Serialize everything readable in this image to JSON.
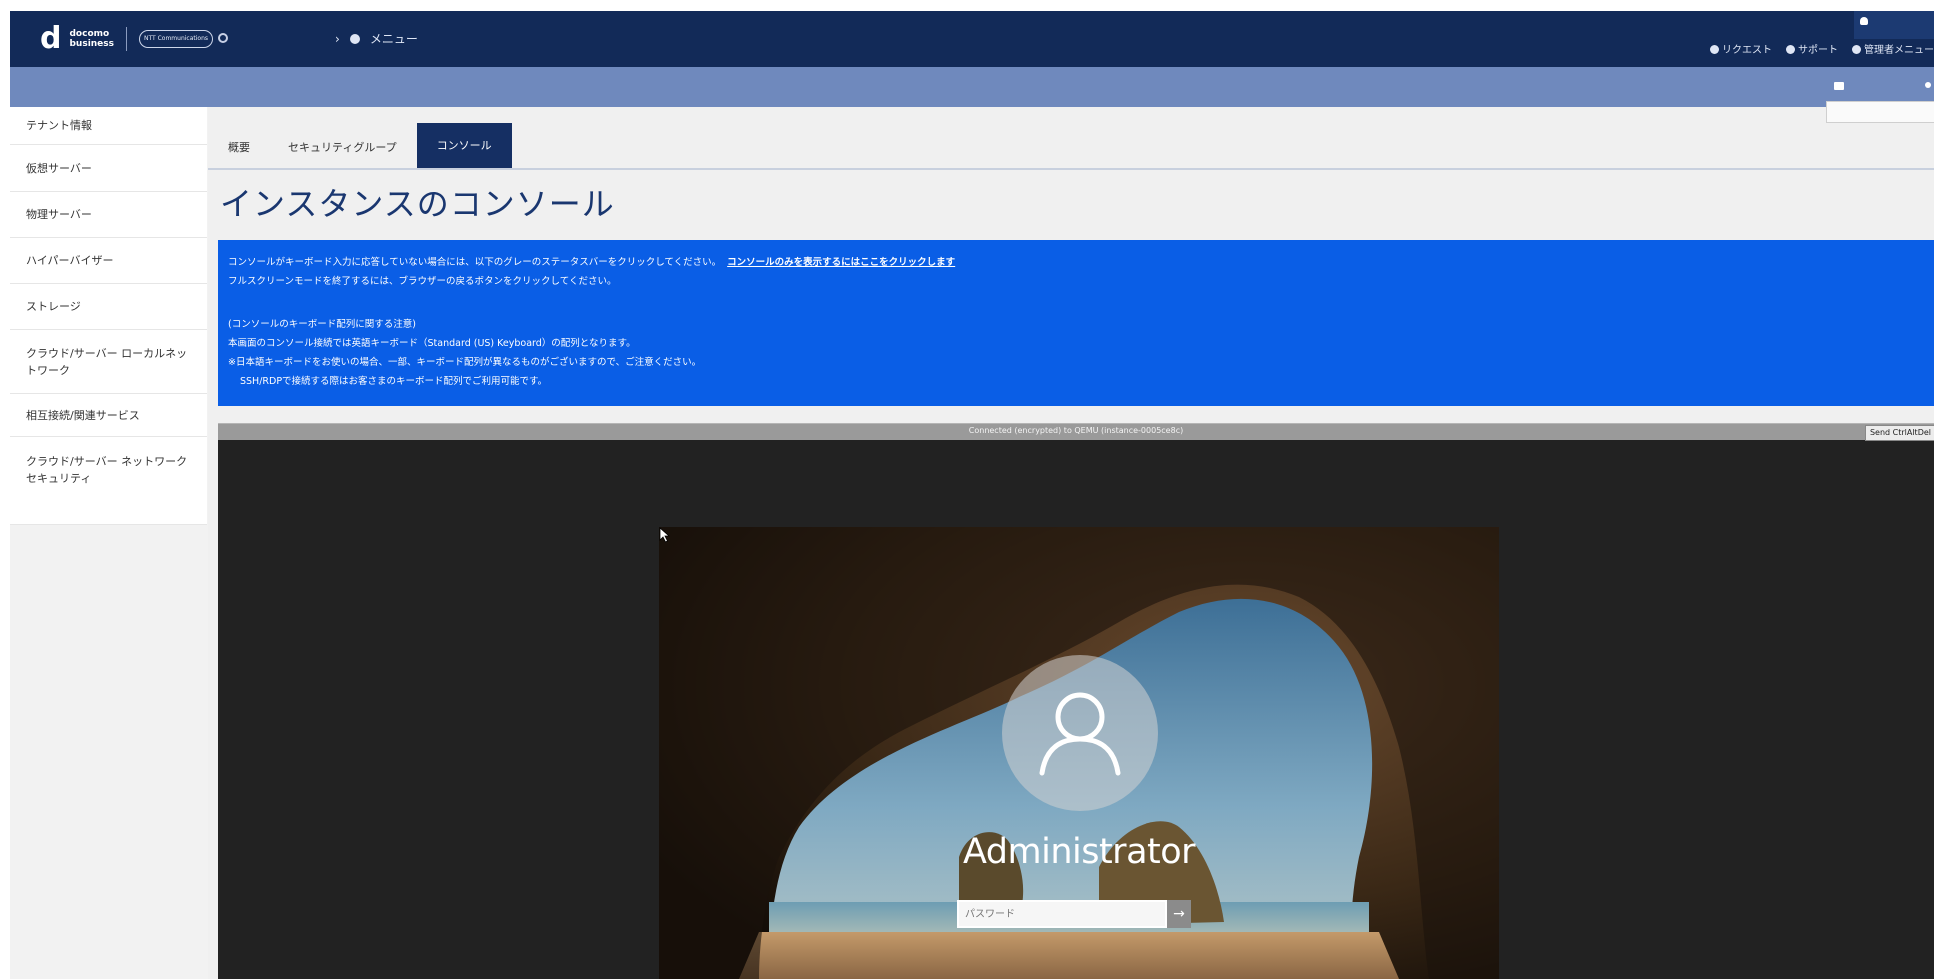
{
  "header": {
    "logo_mark": "d",
    "logo_line1": "docomo",
    "logo_line2": "business",
    "partner_logo": "NTT Communications",
    "breadcrumb_menu": "メニュー",
    "top_links": [
      "リクエスト",
      "サポート",
      "管理者メニュー"
    ],
    "colors": {
      "header_bg": "#122a58",
      "subbar_bg": "#6f89bd",
      "accent": "#0a5ee6"
    }
  },
  "sidebar": {
    "items": [
      {
        "label": "テナント情報"
      },
      {
        "label": "仮想サーバー"
      },
      {
        "label": "物理サーバー"
      },
      {
        "label": "ハイパーバイザー"
      },
      {
        "label": "ストレージ"
      },
      {
        "label": "クラウド/サーバー ローカルネットワーク"
      },
      {
        "label": "相互接続/関連サービス"
      },
      {
        "label": "クラウド/サーバー ネットワークセキュリティ"
      }
    ]
  },
  "main": {
    "tabs": [
      {
        "label": "概要",
        "active": false
      },
      {
        "label": "セキュリティグループ",
        "active": false
      },
      {
        "label": "コンソール",
        "active": true
      }
    ],
    "title": "インスタンスのコンソール",
    "notice": {
      "line1": "コンソールがキーボード入力に応答していない場合には、以下のグレーのステータスバーをクリックしてください。",
      "line1_link": "コンソールのみを表示するにはここをクリックします",
      "line2": "フルスクリーンモードを終了するには、ブラウザーの戻るボタンをクリックしてください。",
      "line3": "(コンソールのキーボード配列に関する注意)",
      "line4": "本画面のコンソール接続では英語キーボード（Standard (US) Keyboard）の配列となります。",
      "line5": "※日本語キーボードをお使いの場合、一部、キーボード配列が異なるものがございますので、ご注意ください。",
      "line6": "SSH/RDPで接続する際はお客さまのキーボード配列でご利用可能です。"
    },
    "console": {
      "status": "Connected (encrypted) to QEMU (instance-0005ce8c)",
      "send_cad": "Send CtrlAltDel",
      "user_name": "Administrator",
      "password_placeholder": "パスワード",
      "submit_glyph": "→"
    }
  }
}
